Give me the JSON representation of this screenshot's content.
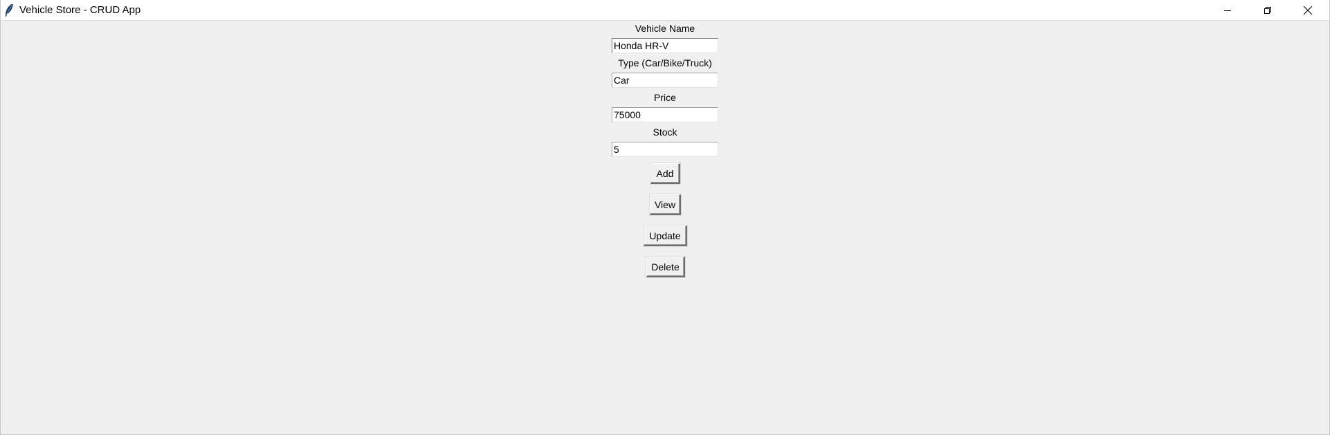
{
  "window": {
    "title": "Vehicle Store - CRUD App",
    "controls": {
      "minimize_icon": "minimize-icon",
      "maximize_icon": "restore-icon",
      "close_icon": "close-icon"
    }
  },
  "form": {
    "fields": [
      {
        "label": "Vehicle Name",
        "value": "Honda HR-V"
      },
      {
        "label": "Type (Car/Bike/Truck)",
        "value": "Car"
      },
      {
        "label": "Price",
        "value": "75000"
      },
      {
        "label": "Stock",
        "value": "5"
      }
    ],
    "buttons": {
      "add": "Add",
      "view": "View",
      "update": "Update",
      "delete": "Delete"
    }
  },
  "colors": {
    "background": "#f0f0f0",
    "titlebar": "#ffffff",
    "entry_background": "#ffffff"
  }
}
